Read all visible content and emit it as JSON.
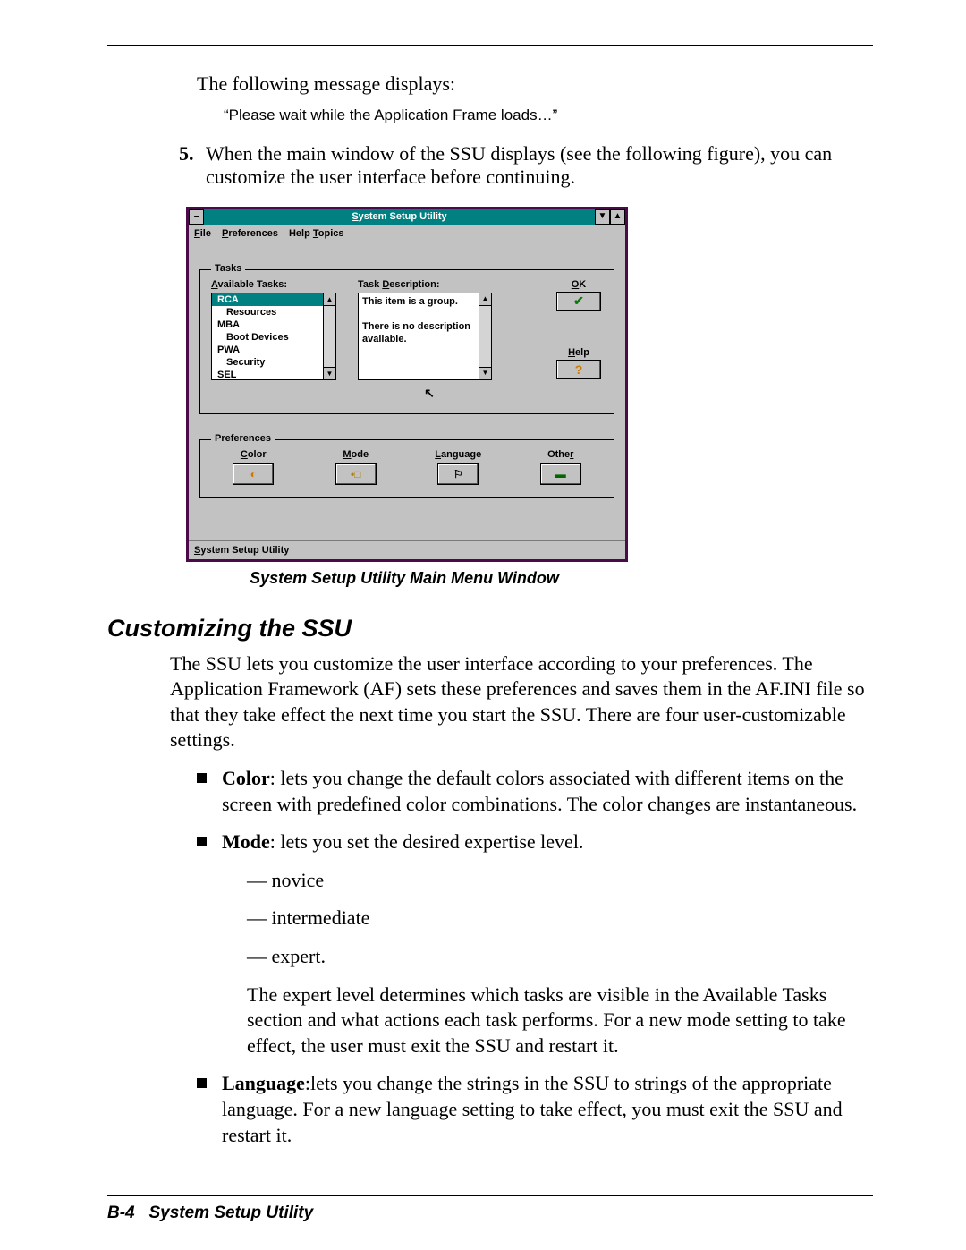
{
  "intro": {
    "line1": "The following message displays:",
    "quote": "“Please wait while the Application Frame loads…”"
  },
  "step5": {
    "num": "5.",
    "text": "When the main window of the SSU displays (see the following figure), you can customize the user interface before continuing."
  },
  "window": {
    "title": "System Setup Utility",
    "sysmenu": "–",
    "min": "▼",
    "max": "▲",
    "menu": {
      "file": "File",
      "prefs": "Preferences",
      "help": "Help Topics"
    },
    "tasks": {
      "legend": "Tasks",
      "avail_lbl": "Available Tasks:",
      "desc_lbl": "Task Description:",
      "items": [
        "RCA",
        "Resources",
        "MBA",
        "Boot Devices",
        "PWA",
        "Security",
        "SEL"
      ],
      "selected_index": 0,
      "indent_flags": [
        false,
        true,
        false,
        true,
        false,
        true,
        false
      ],
      "description": "This item is a group.\n\nThere is no description available.",
      "ok_lbl": "OK",
      "ok_icon": "✔",
      "help_lbl": "Help",
      "help_icon": "?"
    },
    "prefs": {
      "legend": "Preferences",
      "color": "Color",
      "mode": "Mode",
      "language": "Language",
      "other": "Other",
      "color_icon": "◐",
      "mode_icon": "•□",
      "lang_icon": "⚐",
      "other_icon": "▬"
    },
    "status": "System Setup Utility",
    "cursor": "↖"
  },
  "caption": "System Setup Utility Main Menu Window",
  "h2": "Customizing the SSU",
  "para1": "The SSU lets you customize the user interface according to your preferences. The Application Framework (AF) sets these preferences and saves them in the AF.INI file so that they take effect the next time you start the SSU. There are four user-customizable settings.",
  "bullets": {
    "color": {
      "label": "Color",
      "text": ": lets you change the default colors associated with different items on the screen with predefined color combinations. The color changes are instantaneous."
    },
    "mode": {
      "label": "Mode",
      "text": ": lets you set the desired expertise level.",
      "levels": [
        "novice",
        "intermediate",
        "expert."
      ],
      "after": "The expert level determines which tasks are visible in the Available Tasks section and what actions each task performs. For a new mode setting to take effect, the user must exit the SSU and restart it."
    },
    "language": {
      "label": "Language",
      "text": ":lets you change the strings in the SSU to strings of the appropriate language. For a new language setting to take effect, you must exit the SSU and restart it."
    }
  },
  "footer": {
    "page": "B-4",
    "title": "System Setup Utility"
  }
}
